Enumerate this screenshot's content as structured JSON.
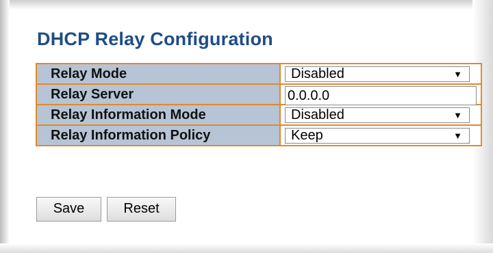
{
  "page": {
    "title": "DHCP Relay Configuration"
  },
  "config": {
    "rows": [
      {
        "label": "Relay Mode",
        "type": "select",
        "value": "Disabled"
      },
      {
        "label": "Relay Server",
        "type": "input",
        "value": "0.0.0.0"
      },
      {
        "label": "Relay Information Mode",
        "type": "select",
        "value": "Disabled"
      },
      {
        "label": "Relay Information Policy",
        "type": "select",
        "value": "Keep"
      }
    ]
  },
  "buttons": {
    "save_label": "Save",
    "reset_label": "Reset"
  },
  "colors": {
    "title": "#1e4d86",
    "label_bg": "#b7c4d5",
    "border": "#e0892a"
  },
  "icons": {
    "dropdown": "dropdown-arrow-icon"
  }
}
